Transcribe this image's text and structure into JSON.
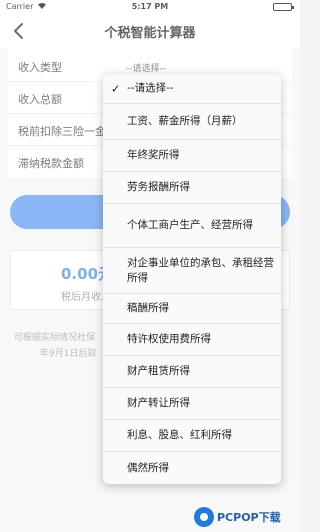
{
  "status_bar": {
    "carrier": "Carrier",
    "time": "5:17 PM",
    "battery_level": 1.0
  },
  "nav_bar": {
    "title": "个税智能计算器",
    "back_icon": "chevron-left-icon"
  },
  "form": {
    "rows": [
      {
        "label": "收入类型",
        "value": "--请选择--"
      },
      {
        "label": "收入总额",
        "value": ""
      },
      {
        "label": "税前扣除三险一金",
        "value": ""
      },
      {
        "label": "滞纳税款金额",
        "value": ""
      }
    ]
  },
  "result": {
    "amount": "0.00元",
    "caption": "税后月收入"
  },
  "footer_note": {
    "line1": "可根据实际情况社保",
    "line2": "年9月1日后取"
  },
  "dropdown": {
    "selected_index": 0,
    "options": [
      "--请选择--",
      "工资、薪金所得（月薪）",
      "年终奖所得",
      "劳务报酬所得",
      "个体工商户生产、经营所得",
      "对企事业单位的承包、承租经营所得",
      "稿酬所得",
      "特许权使用费所得",
      "财产租赁所得",
      "财产转让所得",
      "利息、股息、红利所得",
      "偶然所得"
    ]
  },
  "watermark": {
    "text": "PCPOP下载"
  },
  "colors": {
    "accent": "#4c8ff0",
    "amount": "#3a86e8",
    "background": "#f4f4f6"
  }
}
